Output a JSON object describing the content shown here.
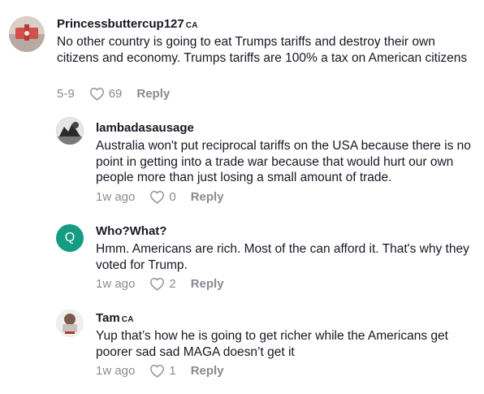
{
  "comments": [
    {
      "username": "Princessbuttercup127",
      "flair": "CA",
      "text": "No other country is going to eat Trumps tariffs and destroy their own citizens and economy. Trumps tariffs are 100% a tax on American citizens",
      "date": "5-9",
      "likes": "69",
      "reply_label": "Reply"
    },
    {
      "username": "lambadasausage",
      "text": "Australia won't put reciprocal tariffs on the USA because there is no point in getting into a trade war because that would hurt our own people more than just losing a small amount of trade.",
      "date": "1w ago",
      "likes": "0",
      "reply_label": "Reply"
    },
    {
      "username": "Who?What?",
      "avatar_letter": "Q",
      "text": "Hmm. Americans are rich. Most of the can afford it. That's why they voted for Trump.",
      "date": "1w ago",
      "likes": "2",
      "reply_label": "Reply"
    },
    {
      "username": "Tam",
      "flair": "CA",
      "text": "Yup that’s how he is going to get richer while the Americans get poorer sad sad MAGA doesn’t get it",
      "date": "1w ago",
      "likes": "1",
      "reply_label": "Reply"
    }
  ],
  "colors": {
    "text": "#161823",
    "meta": "#8a8b91",
    "q_avatar": "#169c82"
  }
}
